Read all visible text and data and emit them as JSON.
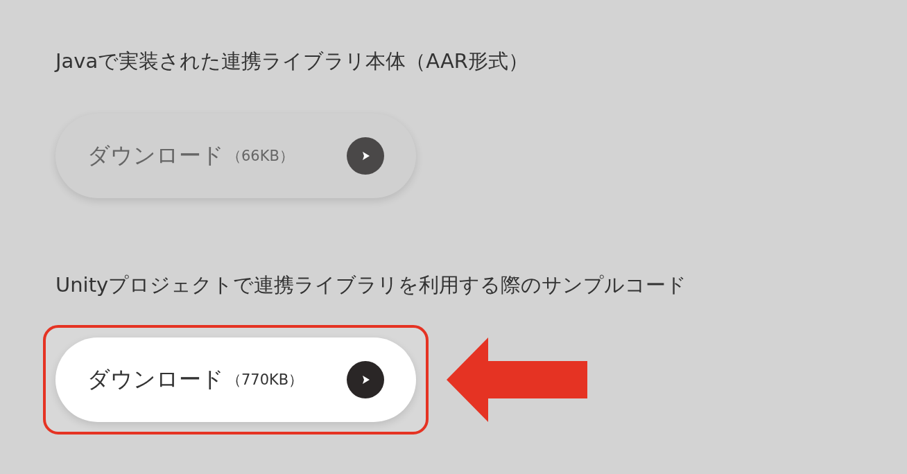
{
  "sections": [
    {
      "heading": "Javaで実装された連携ライブラリ本体（AAR形式）",
      "button": {
        "label": "ダウンロード",
        "size": "（66KB）",
        "highlighted": false
      }
    },
    {
      "heading": "Unityプロジェクトで連携ライブラリを利用する際のサンプルコード",
      "button": {
        "label": "ダウンロード",
        "size": "（770KB）",
        "highlighted": true
      }
    }
  ]
}
